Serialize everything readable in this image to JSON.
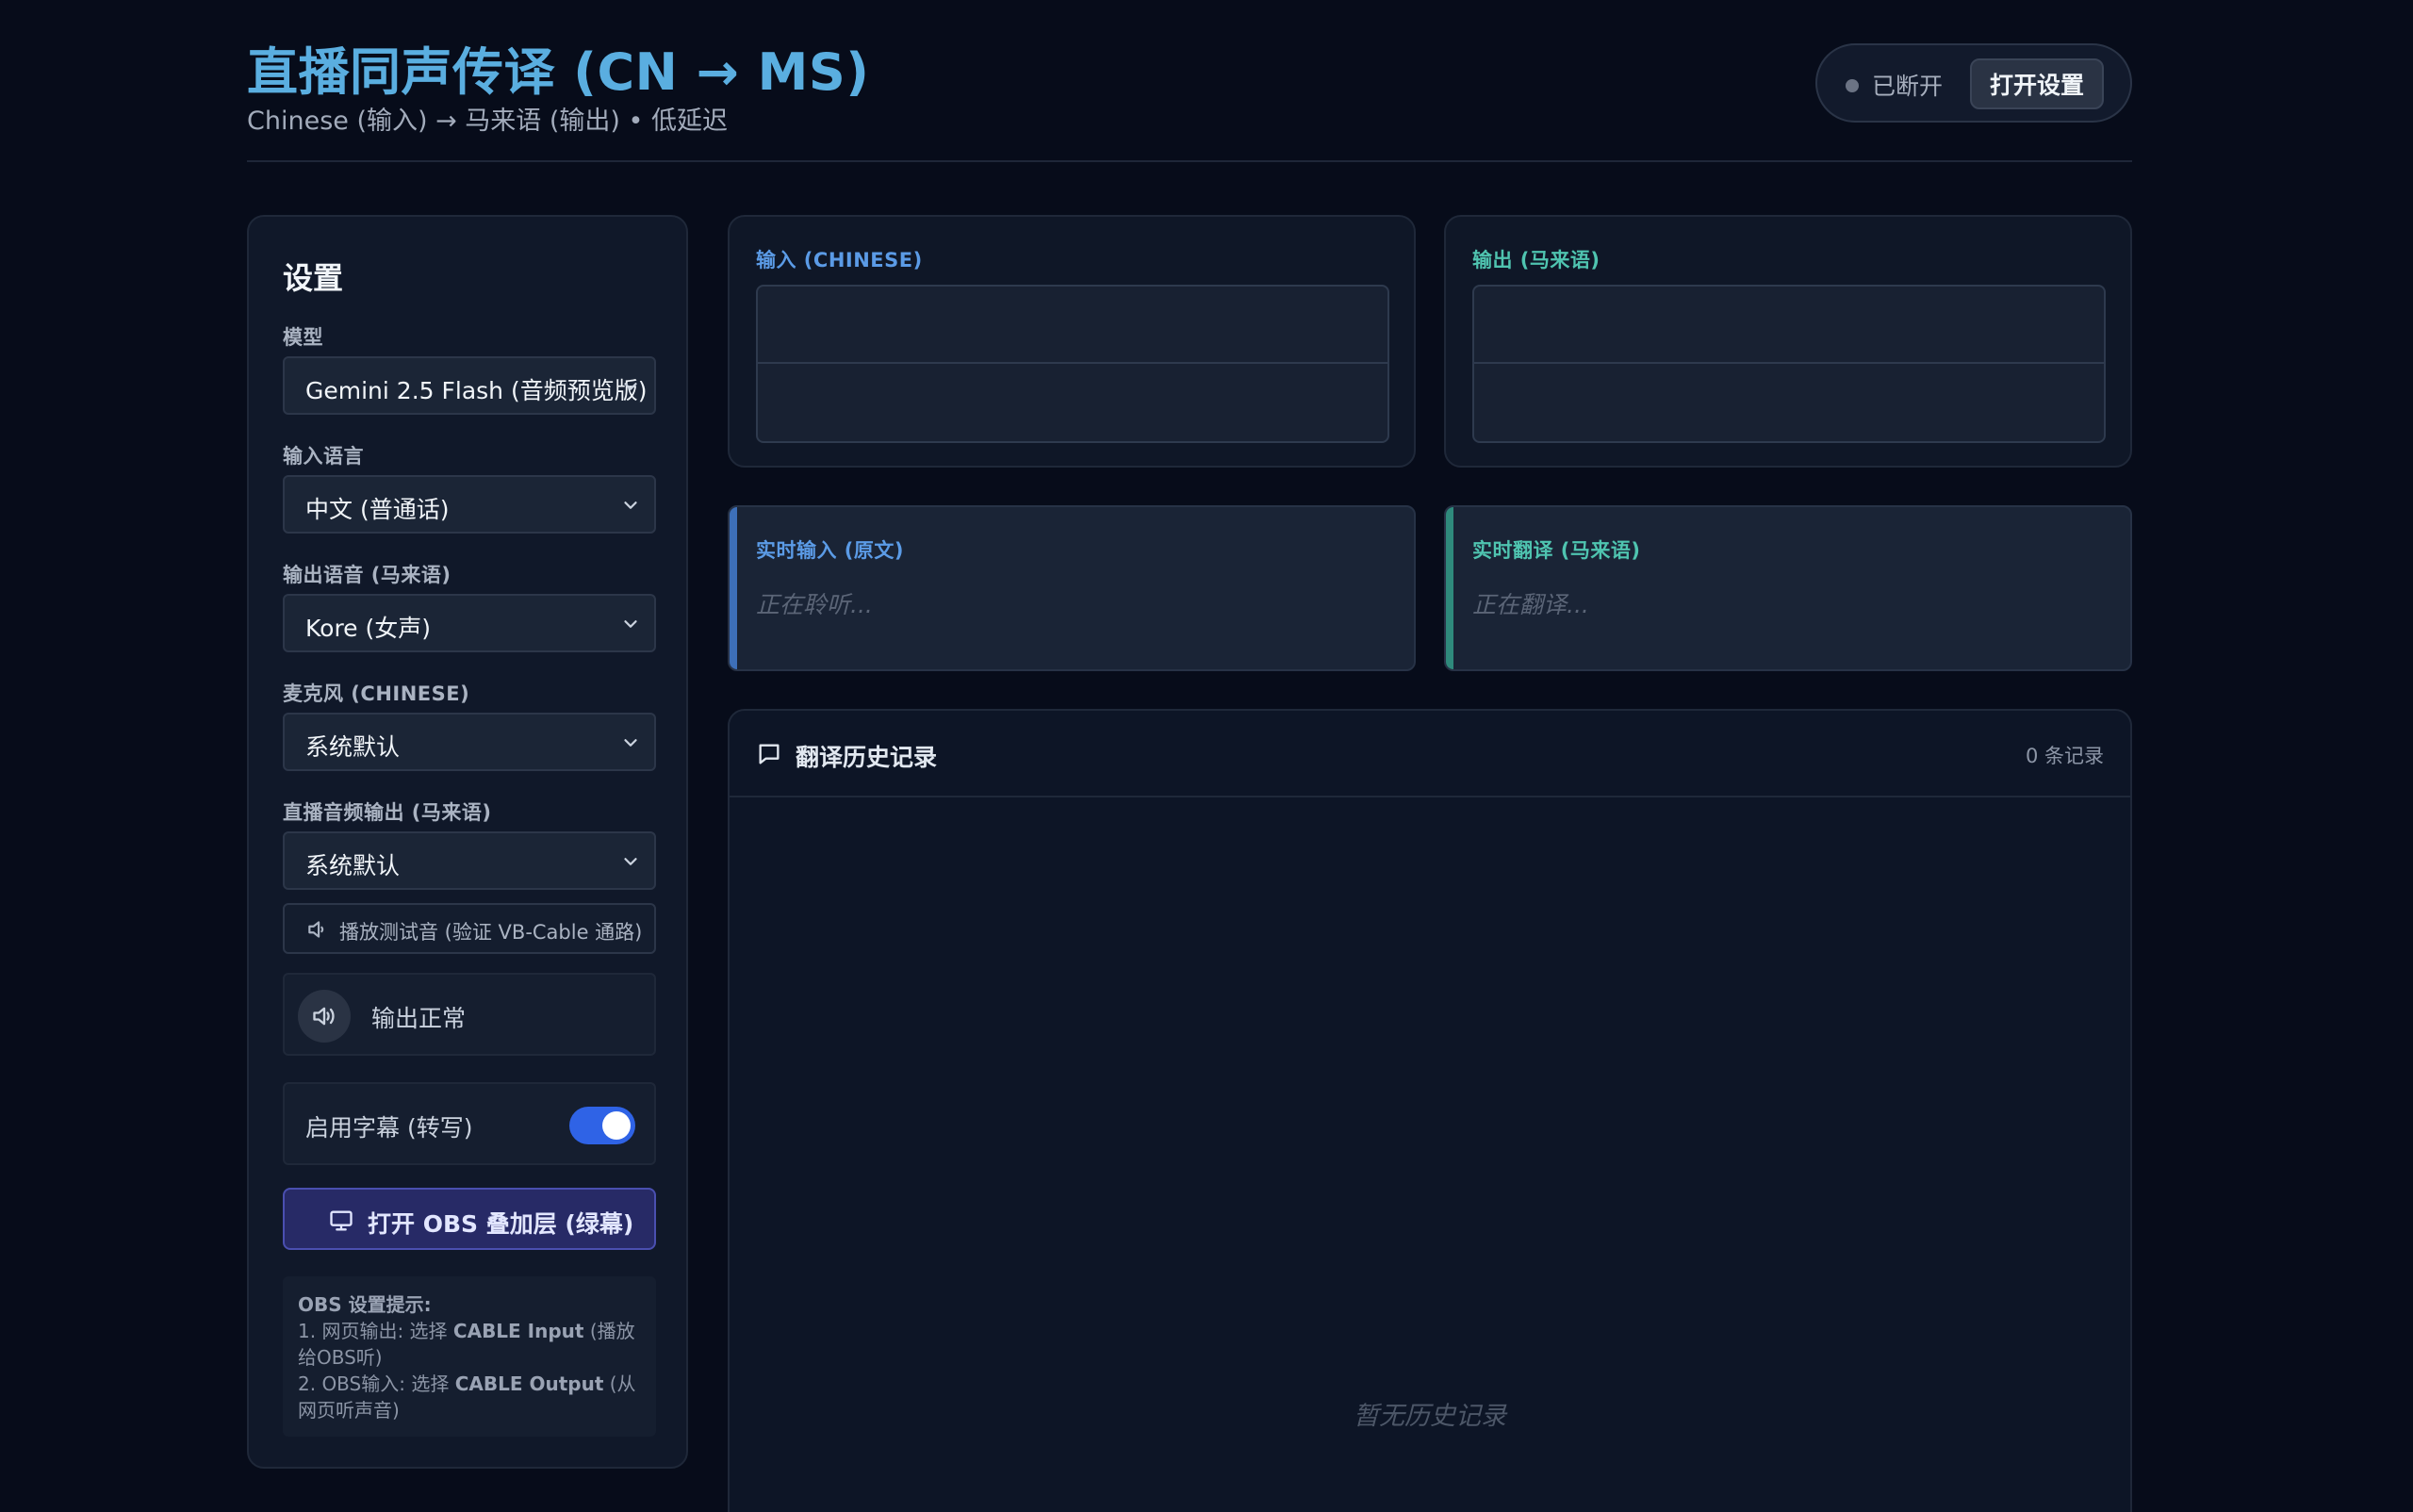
{
  "header": {
    "title": "直播同声传译 (CN → MS)",
    "subtitle": "Chinese (输入) → 马来语 (输出) • 低延迟",
    "status": "已断开",
    "open_settings": "打开设置"
  },
  "settings": {
    "title": "设置",
    "model_label": "模型",
    "model_value": "Gemini 2.5 Flash (音频预览版)",
    "input_lang_label": "输入语言",
    "input_lang_value": "中文 (普通话)",
    "voice_label": "输出语音 (马来语)",
    "voice_value": "Kore (女声)",
    "mic_label": "麦克风 (CHINESE)",
    "mic_value": "系统默认",
    "audio_out_label": "直播音频输出 (马来语)",
    "audio_out_value": "系统默认",
    "test_sound": "播放测试音 (验证 VB-Cable 通路)",
    "output_status": "输出正常",
    "subtitles_label": "启用字幕 (转写)",
    "subtitles_enabled": true,
    "obs_button": "打开 OBS 叠加层 (绿幕)",
    "hint_title": "OBS 设置提示:",
    "hint_line1_a": "1. 网页输出: 选择 ",
    "hint_line1_b": "CABLE Input",
    "hint_line1_c": " (播放给OBS听)",
    "hint_line2_a": "2. OBS输入: 选择 ",
    "hint_line2_b": "CABLE Output",
    "hint_line2_c": " (从网页听声音)"
  },
  "input_card": {
    "label": "输入 (CHINESE)"
  },
  "output_card": {
    "label": "输出 (马来语)"
  },
  "live_input": {
    "label": "实时输入 (原文)",
    "placeholder": "正在聆听..."
  },
  "live_output": {
    "label": "实时翻译 (马来语)",
    "placeholder": "正在翻译..."
  },
  "history": {
    "title": "翻译历史记录",
    "count": "0 条记录",
    "empty": "暂无历史记录"
  },
  "colors": {
    "input_accent": "#5b9be6",
    "output_accent": "#4fc4b0",
    "toggle": "#2f63e6"
  }
}
